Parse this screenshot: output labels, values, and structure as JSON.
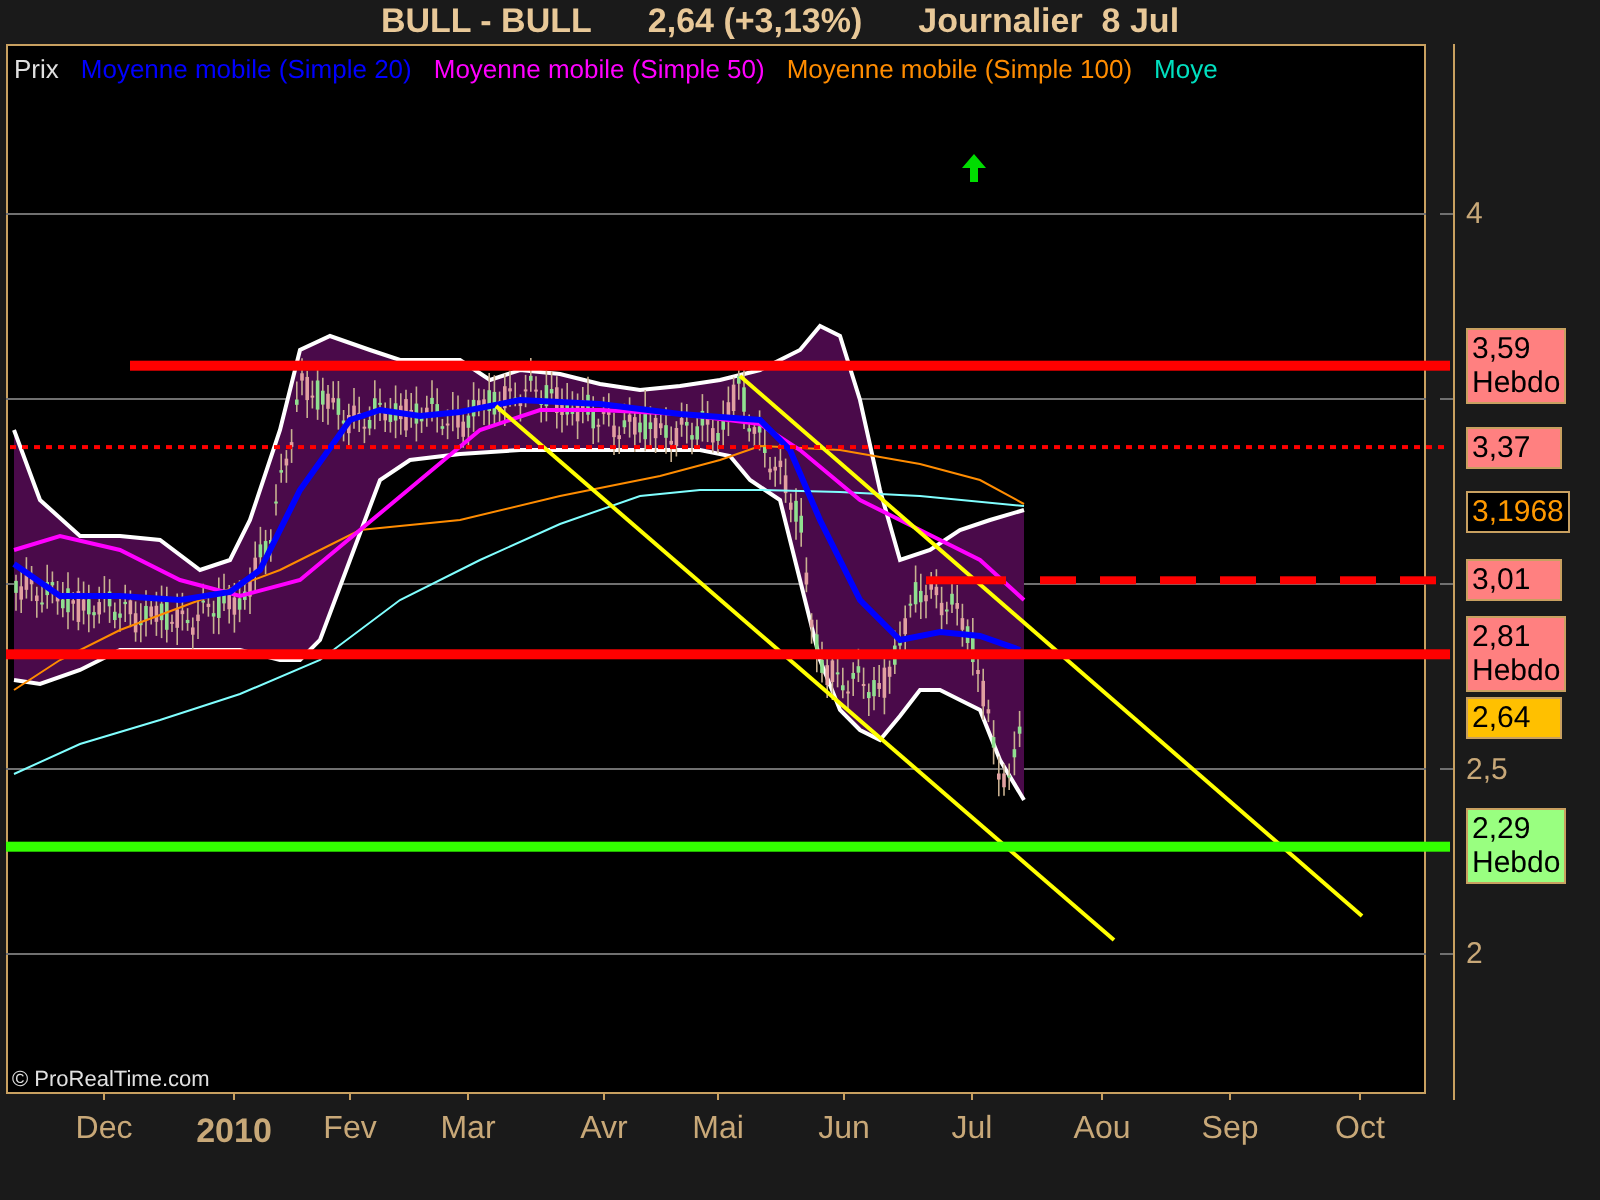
{
  "title": {
    "symbol": "BULL - BULL",
    "quote": "2,64 (+3,13%)",
    "period": "Journalier  8 Jul"
  },
  "legend": [
    {
      "label": "Prix",
      "color": "#e0e0e0"
    },
    {
      "label": "Moyenne mobile (Simple 20)",
      "color": "#0000ff"
    },
    {
      "label": "Moyenne mobile (Simple 50)",
      "color": "#ff00ff"
    },
    {
      "label": "Moyenne mobile (Simple 100)",
      "color": "#ff8c00"
    },
    {
      "label": "Moye",
      "color": "#00e0c0"
    }
  ],
  "y_ticks": [
    "4",
    "2,5",
    "2"
  ],
  "price_labels": [
    {
      "value": "3,59",
      "note": "Hebdo",
      "kind": "level",
      "color": "#ff8080",
      "line": {
        "kind": "solid",
        "color": "#ff0000"
      }
    },
    {
      "value": "3,37",
      "kind": "level",
      "color": "#ff8080",
      "line": {
        "kind": "dotted",
        "color": "#ff0000"
      }
    },
    {
      "value": "3,1968",
      "kind": "indicator",
      "color": "#ff9900"
    },
    {
      "value": "3,01",
      "kind": "level",
      "color": "#ff8080",
      "line": {
        "kind": "dashed",
        "color": "#ff0000"
      }
    },
    {
      "value": "2,81",
      "note": "Hebdo",
      "kind": "level",
      "color": "#ff8080",
      "line": {
        "kind": "solid",
        "color": "#ff0000"
      }
    },
    {
      "value": "2,64",
      "kind": "last",
      "color": "#ffc000"
    },
    {
      "value": "2,29",
      "note": "Hebdo",
      "kind": "level",
      "color": "#99ff80",
      "line": {
        "kind": "solid",
        "color": "#33ff00"
      }
    }
  ],
  "copyright": "© ProRealTime.com",
  "x_labels": [
    {
      "label": "Dec",
      "year": false
    },
    {
      "label": "2010",
      "year": true
    },
    {
      "label": "Fev",
      "year": false
    },
    {
      "label": "Mar",
      "year": false
    },
    {
      "label": "Avr",
      "year": false
    },
    {
      "label": "Mai",
      "year": false
    },
    {
      "label": "Jun",
      "year": false
    },
    {
      "label": "Jul",
      "year": false
    },
    {
      "label": "Aou",
      "year": false
    },
    {
      "label": "Sep",
      "year": false
    },
    {
      "label": "Oct",
      "year": false
    }
  ]
}
